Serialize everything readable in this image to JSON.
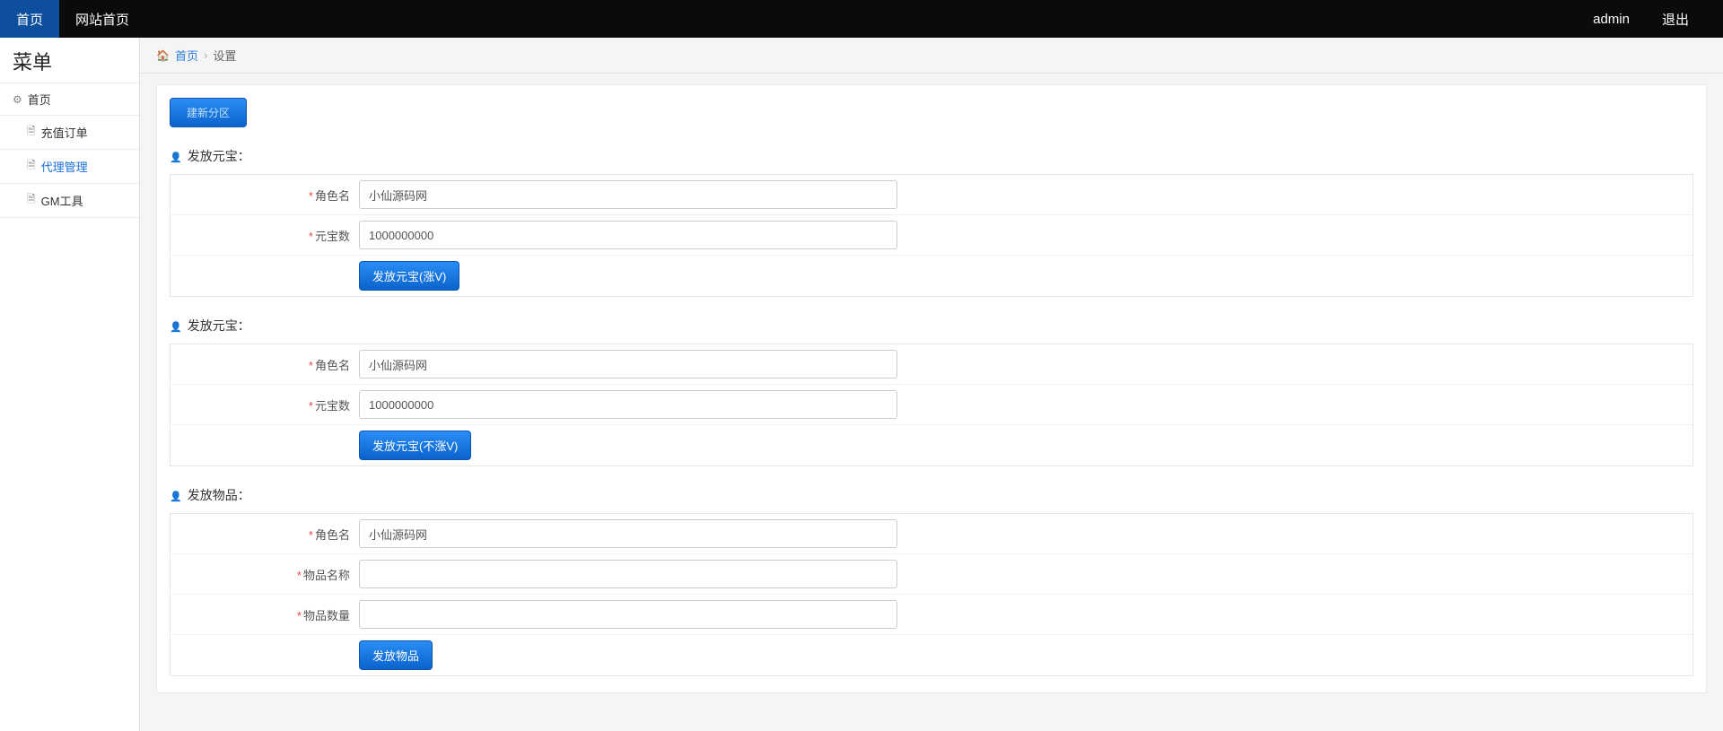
{
  "navbar": {
    "left": [
      {
        "label": "首页",
        "active": true
      },
      {
        "label": "网站首页",
        "active": false
      }
    ],
    "right": [
      {
        "label": "admin"
      },
      {
        "label": "退出"
      }
    ]
  },
  "sidebar": {
    "title": "菜单",
    "root": {
      "label": "首页"
    },
    "items": [
      {
        "label": "充值订单",
        "active": false
      },
      {
        "label": "代理管理",
        "active": true
      },
      {
        "label": "GM工具",
        "active": false
      }
    ]
  },
  "breadcrumb": {
    "home": "首页",
    "current": "设置"
  },
  "top_button": "建新分区",
  "sections": [
    {
      "title": "发放元宝：",
      "rows": [
        {
          "label": "角色名",
          "value": "小仙源码网"
        },
        {
          "label": "元宝数",
          "value": "1000000000"
        }
      ],
      "button": "发放元宝(涨V)"
    },
    {
      "title": "发放元宝：",
      "rows": [
        {
          "label": "角色名",
          "value": "小仙源码网"
        },
        {
          "label": "元宝数",
          "value": "1000000000"
        }
      ],
      "button": "发放元宝(不涨V)"
    },
    {
      "title": "发放物品：",
      "rows": [
        {
          "label": "角色名",
          "value": "小仙源码网"
        },
        {
          "label": "物品名称",
          "value": ""
        },
        {
          "label": "物品数量",
          "value": ""
        }
      ],
      "button": "发放物品"
    }
  ]
}
